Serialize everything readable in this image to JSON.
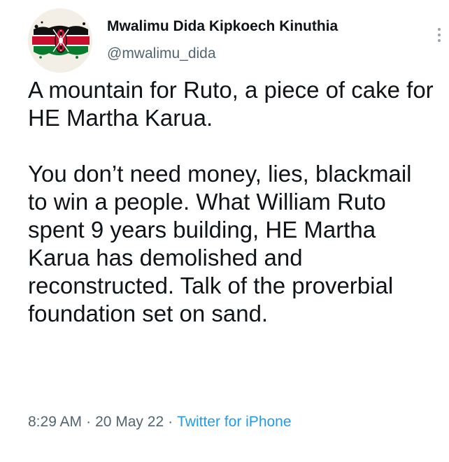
{
  "author": {
    "name": "Mwalimu Dida Kipkoech Kinuthia",
    "handle": "@mwalimu_dida",
    "avatar_icon": "kenyan-flag-avatar-icon"
  },
  "tweet": {
    "paragraphs": [
      "A mountain for Ruto, a piece of cake for HE Martha Karua.",
      "You don’t need money, lies, blackmail to win a people. What William Ruto spent 9 years building, HE Martha Karua has demolished and reconstructed. Talk of the proverbial foundation set on sand."
    ]
  },
  "meta": {
    "time": "8:29 AM",
    "separator": "·",
    "date": "20 May 22",
    "source": "Twitter for iPhone"
  },
  "colors": {
    "text": "#0f1419",
    "secondary": "#536471",
    "link": "#1d9bf0",
    "flag_black": "#111111",
    "flag_red": "#c8102e",
    "flag_green": "#0a7a2f"
  },
  "more_icon": "more-options-icon"
}
